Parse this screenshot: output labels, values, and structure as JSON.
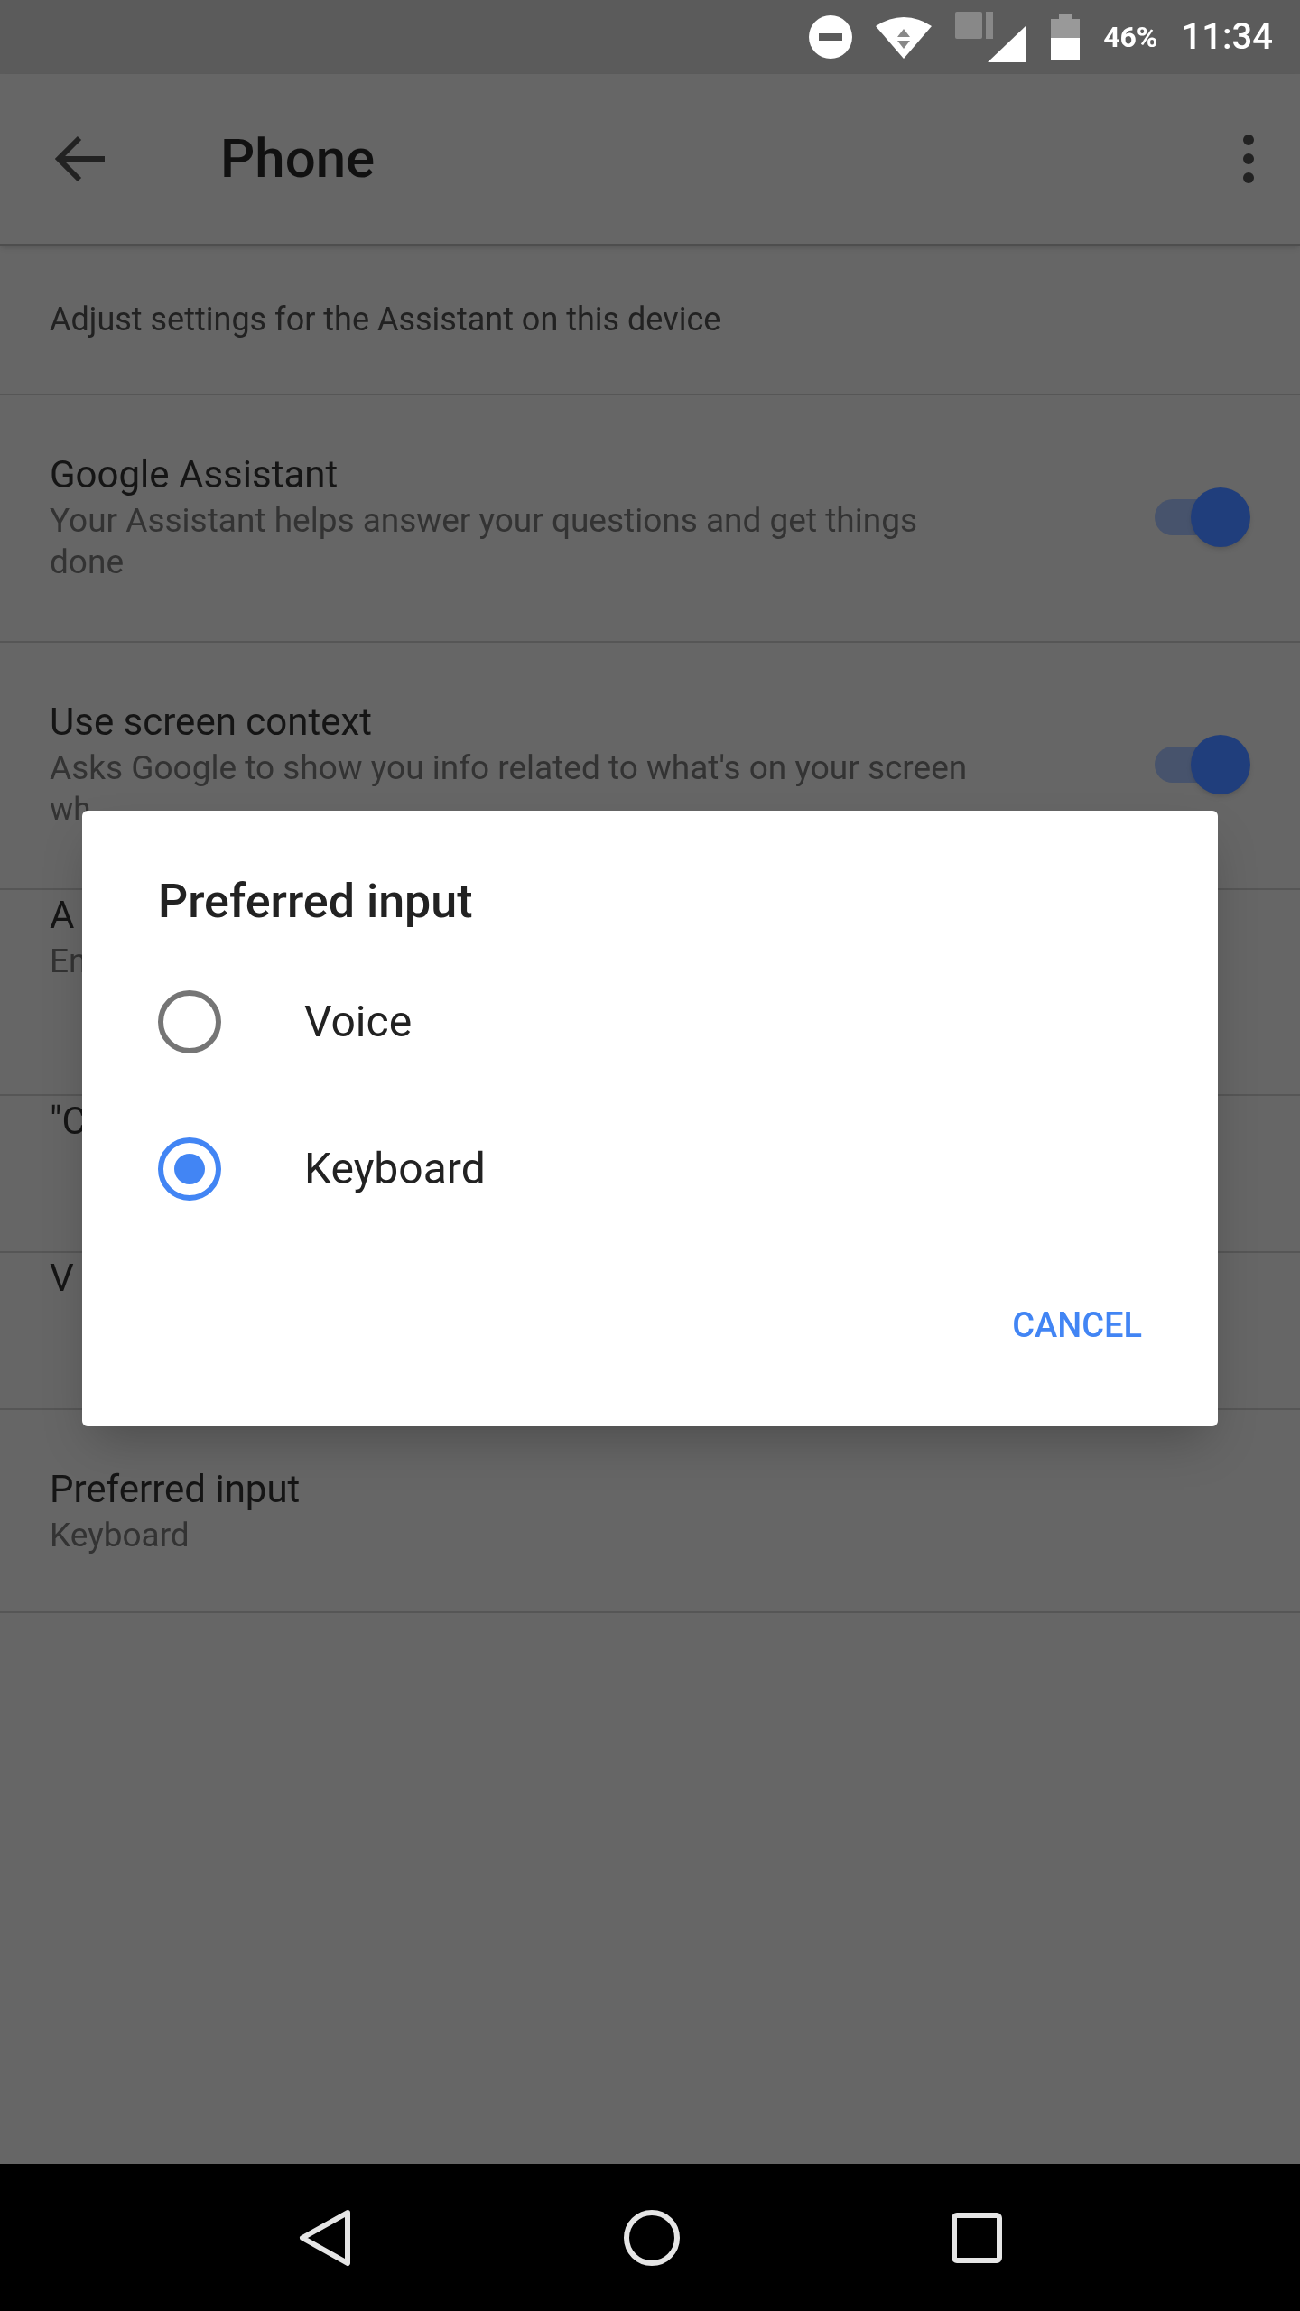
{
  "status_bar": {
    "battery": "46%",
    "time": "11:34"
  },
  "app_bar": {
    "title": "Phone"
  },
  "description": "Adjust settings for the Assistant on this device",
  "settings": [
    {
      "kind": "toggle",
      "title": "Google Assistant",
      "subtitle": "Your Assistant helps answer your questions and get things done",
      "on": true
    },
    {
      "kind": "toggle",
      "title": "Use screen context",
      "subtitle": "Asks Google to show you info related to what's on your screen",
      "subtitle_cut": "wh",
      "on": true
    },
    {
      "kind": "covered",
      "title": "A",
      "subtitle": "En"
    },
    {
      "kind": "covered",
      "title": "\"C"
    },
    {
      "kind": "covered",
      "title": "V"
    },
    {
      "kind": "plain",
      "title": "Preferred input",
      "subtitle": "Keyboard"
    }
  ],
  "dialog": {
    "title": "Preferred input",
    "options": [
      {
        "label": "Voice",
        "selected": false
      },
      {
        "label": "Keyboard",
        "selected": true
      }
    ],
    "button": "CANCEL"
  }
}
